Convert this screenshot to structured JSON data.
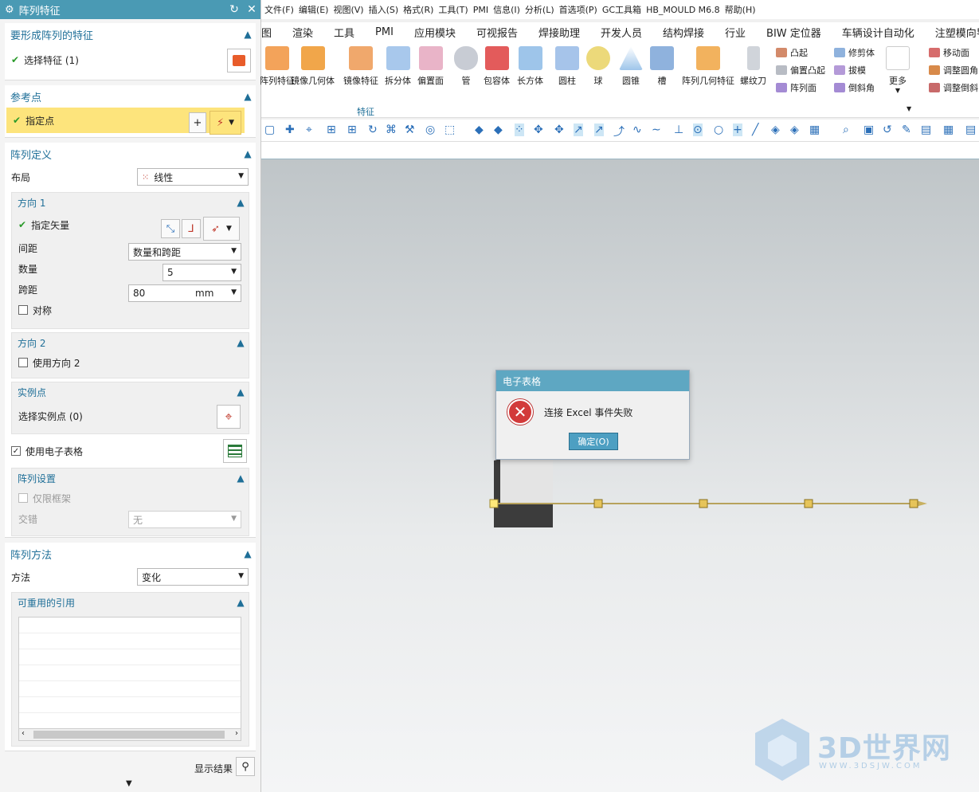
{
  "dialog": {
    "title": "阵列特征",
    "features_section": {
      "title": "要形成阵列的特征",
      "select_label": "选择特征 (1)"
    },
    "reference_section": {
      "title": "参考点",
      "specify_point": "指定点"
    },
    "definition_section": {
      "title": "阵列定义",
      "layout_label": "布局",
      "layout_value": "线性",
      "direction1": {
        "title": "方向 1",
        "specify_vector": "指定矢量",
        "spacing_label": "间距",
        "spacing_value": "数量和跨距",
        "count_label": "数量",
        "count_value": "5",
        "span_label": "跨距",
        "span_value": "80",
        "span_unit": "mm",
        "symmetric_label": "对称"
      },
      "direction2": {
        "title": "方向 2",
        "use_direction2": "使用方向 2"
      },
      "instance_points": {
        "title": "实例点",
        "select_label": "选择实例点 (0)"
      },
      "use_spreadsheet": "使用电子表格",
      "settings": {
        "title": "阵列设置",
        "frame_only": "仅限框架",
        "stagger_label": "交错",
        "stagger_value": "无"
      }
    },
    "method_section": {
      "title": "阵列方法",
      "method_label": "方法",
      "method_value": "变化",
      "reusable_refs": "可重用的引用"
    },
    "show_result": "显示结果"
  },
  "menubar": [
    "文件(F)",
    "编辑(E)",
    "视图(V)",
    "插入(S)",
    "格式(R)",
    "工具(T)",
    "PMI",
    "信息(I)",
    "分析(L)",
    "首选项(P)",
    "GC工具箱",
    "HB_MOULD M6.8",
    "帮助(H)"
  ],
  "tabs": [
    "图",
    "渲染",
    "工具",
    "PMI",
    "应用模块",
    "可视报告",
    "焊接助理",
    "开发人员",
    "结构焊接",
    "行业",
    "BIW 定位器",
    "车辆设计自动化",
    "注塑模向导"
  ],
  "ribbon": {
    "buttons": [
      "阵列特征",
      "镜像几何体",
      "镜像特征",
      "拆分体",
      "偏置面",
      "管",
      "包容体",
      "长方体",
      "圆柱",
      "球",
      "圆锥",
      "槽",
      "阵列几何特征",
      "螺纹刀",
      "更多"
    ],
    "small_col1": [
      "凸起",
      "偏置凸起",
      "阵列面"
    ],
    "small_col2": [
      "修剪体",
      "拔模",
      "倒斜角"
    ],
    "small_col3": [
      "移动面",
      "调整圆角",
      "调整倒斜"
    ],
    "group_label": "特征"
  },
  "modal": {
    "title": "电子表格",
    "message": "连接 Excel 事件失败",
    "ok": "确定(O)"
  },
  "watermark": {
    "text": "3D世界网",
    "url": "WWW.3DSJW.COM"
  },
  "colors": {
    "accent": "#4a9ab4",
    "highlight": "#fde47c",
    "header_text": "#1f6f98"
  }
}
